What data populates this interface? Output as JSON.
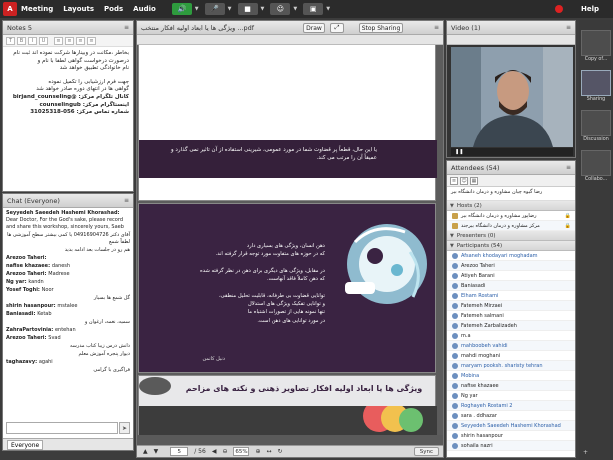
{
  "topbar": {
    "logo_text": "Adobe",
    "menus": [
      "Meeting",
      "Layouts",
      "Pods",
      "Audio"
    ],
    "help_label": "Help"
  },
  "notes": {
    "title": "Notes 5",
    "lines": [
      "بخاطر ،مکانت در وبینارها شرکت نموده اند ثبت نام",
      "درصورت درخواست گواهی لطفا با نام و",
      "نام خانوادگی تطبیق خواهد شد",
      "",
      "جهت فرم ارزشیابی را تکمیل نموده",
      "گواهی ها در انتهای دوره صادر خواهد شد",
      "کانال تلگرام مرکز: @birjand_counseling",
      "اینستاگرام مرکز: counselingub",
      "شماره تماس مرکز: 056-31025318"
    ],
    "bold_lines": [
      6,
      7,
      8
    ]
  },
  "chat": {
    "title": "Chat",
    "audience": "(Everyone)",
    "tab_label": "Everyone",
    "messages": [
      {
        "name": "Seyyedeh Saeedeh Hashemi Khorashad:",
        "text": "Dear Doctor, For the God's sake, please record and share this workshop, sincerely yours, Saeb",
        "rtl": false
      },
      {
        "name": "",
        "text": "آقای دکتر 04916904726 یا کمی بیشتر سطح آموزشی ها لطفاً شمع",
        "rtl": true
      },
      {
        "name": "",
        "text": "هم رو در جلسات بعد ادامه بدید",
        "rtl": true
      },
      {
        "name": "Arezoo Taheri:",
        "text": "",
        "rtl": false
      },
      {
        "name": "nafise khazaee:",
        "text": "danesh",
        "rtl": false
      },
      {
        "name": "Arezoo Taheri:",
        "text": "Madrese",
        "rtl": false
      },
      {
        "name": "Ng yar:",
        "text": "kandn",
        "rtl": false
      },
      {
        "name": "Yosef Toghi:",
        "text": "Noor",
        "rtl": false
      },
      {
        "name": "",
        "text": "گل شمع ها بسیار",
        "rtl": true
      },
      {
        "name": "shirin hasanpour:",
        "text": "mstalee",
        "rtl": false
      },
      {
        "name": "Baniasadi:",
        "text": "Ketab",
        "rtl": false
      },
      {
        "name": "",
        "text": "سمیه، نغمه، ارغوان و",
        "rtl": true
      },
      {
        "name": "ZahraPartovinia:",
        "text": "entehan",
        "rtl": false
      },
      {
        "name": "Arezoo Taheri:",
        "text": "Svad",
        "rtl": false
      },
      {
        "name": "",
        "text": "دانش درس زیبا کتاب مدرسه",
        "rtl": true
      },
      {
        "name": "",
        "text": "دیوار پنجره آموزش معلم",
        "rtl": true
      },
      {
        "name": "taghazavy:",
        "text": "agahi",
        "rtl": false
      },
      {
        "name": "",
        "text": "فراگیری با گرامی",
        "rtl": true
      }
    ]
  },
  "share": {
    "title": "ویژگی ها یا ابعاد اولیه افکار منتخب ...pdf",
    "draw_label": "Draw",
    "stop_label": "Stop Sharing",
    "page1_text": "یا این حال، قطعاً پر قضاوت شما در مورد عمومی، شیرینی استفاده از آن تاثیر نمی گذارد و عمیقاً آن را مرتب می کند.",
    "page2_lines": [
      "ذهن انسان، ویژگی های بسیاری دارد",
      "که در حوزه های متفاوت مورد توجه قرار گرفته اند.",
      "",
      "در مقابل، ویژگی های دیگری برای ذهن در نظر گرفته شده",
      "که ذهن کاملاً فاقد آنهاست.",
      "",
      "توانایی قضاوت بی طرفانه، قابلیت تحلیل منطقی،",
      "و توانایی تفکیک ویژگی های استدلال",
      "تنها نمونه هایی از تصورات اشتباه ما",
      "در مورد توانایی های ذهن است."
    ],
    "page2_signature": "دنیل کاتمن",
    "page3_title": "ویژگی ها یا ابعاد اولیه افکار تصاویر ذهنی و نکته های مزاحم",
    "page_current": "5",
    "page_total": "/ 56",
    "zoom": "65%",
    "sync_label": "Sync"
  },
  "video": {
    "title": "Video",
    "count": "(1)"
  },
  "attendees": {
    "title": "Attendees",
    "count": "(54)",
    "caption": "رضا گیوه چیان مشاوره و درمان دانشگاه بیر",
    "groups": [
      {
        "label": "Hosts (2)",
        "rows": [
          "رضاپور مشاوره و درمان دانشگاه بیر",
          "مرکز مشاوره و درمان دانشگاه بیرجند"
        ],
        "kind": "hosts"
      },
      {
        "label": "Presenters (0)",
        "rows": [],
        "kind": "presenters"
      },
      {
        "label": "Participants (54)",
        "rows": [
          "Afsaneh khodayari moghadam",
          "Arezoo Taheri",
          "Atiyeh Barani",
          "Baniasadi",
          "Elham Rostami",
          "Fatemeh Mirzaei",
          "Fatemeh salmani",
          "Fatemeh Zarbalizadeh",
          "m.a",
          "mahboobeh vahidi",
          "mahdi moghani",
          "maryam pooksh. sharisty tehran",
          "Mobina",
          "nafise khazaee",
          "Ng yar",
          "Roghayeh Rostami 2",
          "sara . ddhazar",
          "Seyyedeh Saeedeh Hashemi Khorashad",
          "shirin hasanpour",
          "sohaila nazri"
        ],
        "kind": "participants"
      }
    ],
    "link_rows": [
      0,
      4,
      9,
      11,
      12,
      15,
      17
    ]
  },
  "rail": {
    "tiles": [
      "Copy of...",
      "Sharing",
      "Discussion",
      "Collabo..."
    ]
  }
}
